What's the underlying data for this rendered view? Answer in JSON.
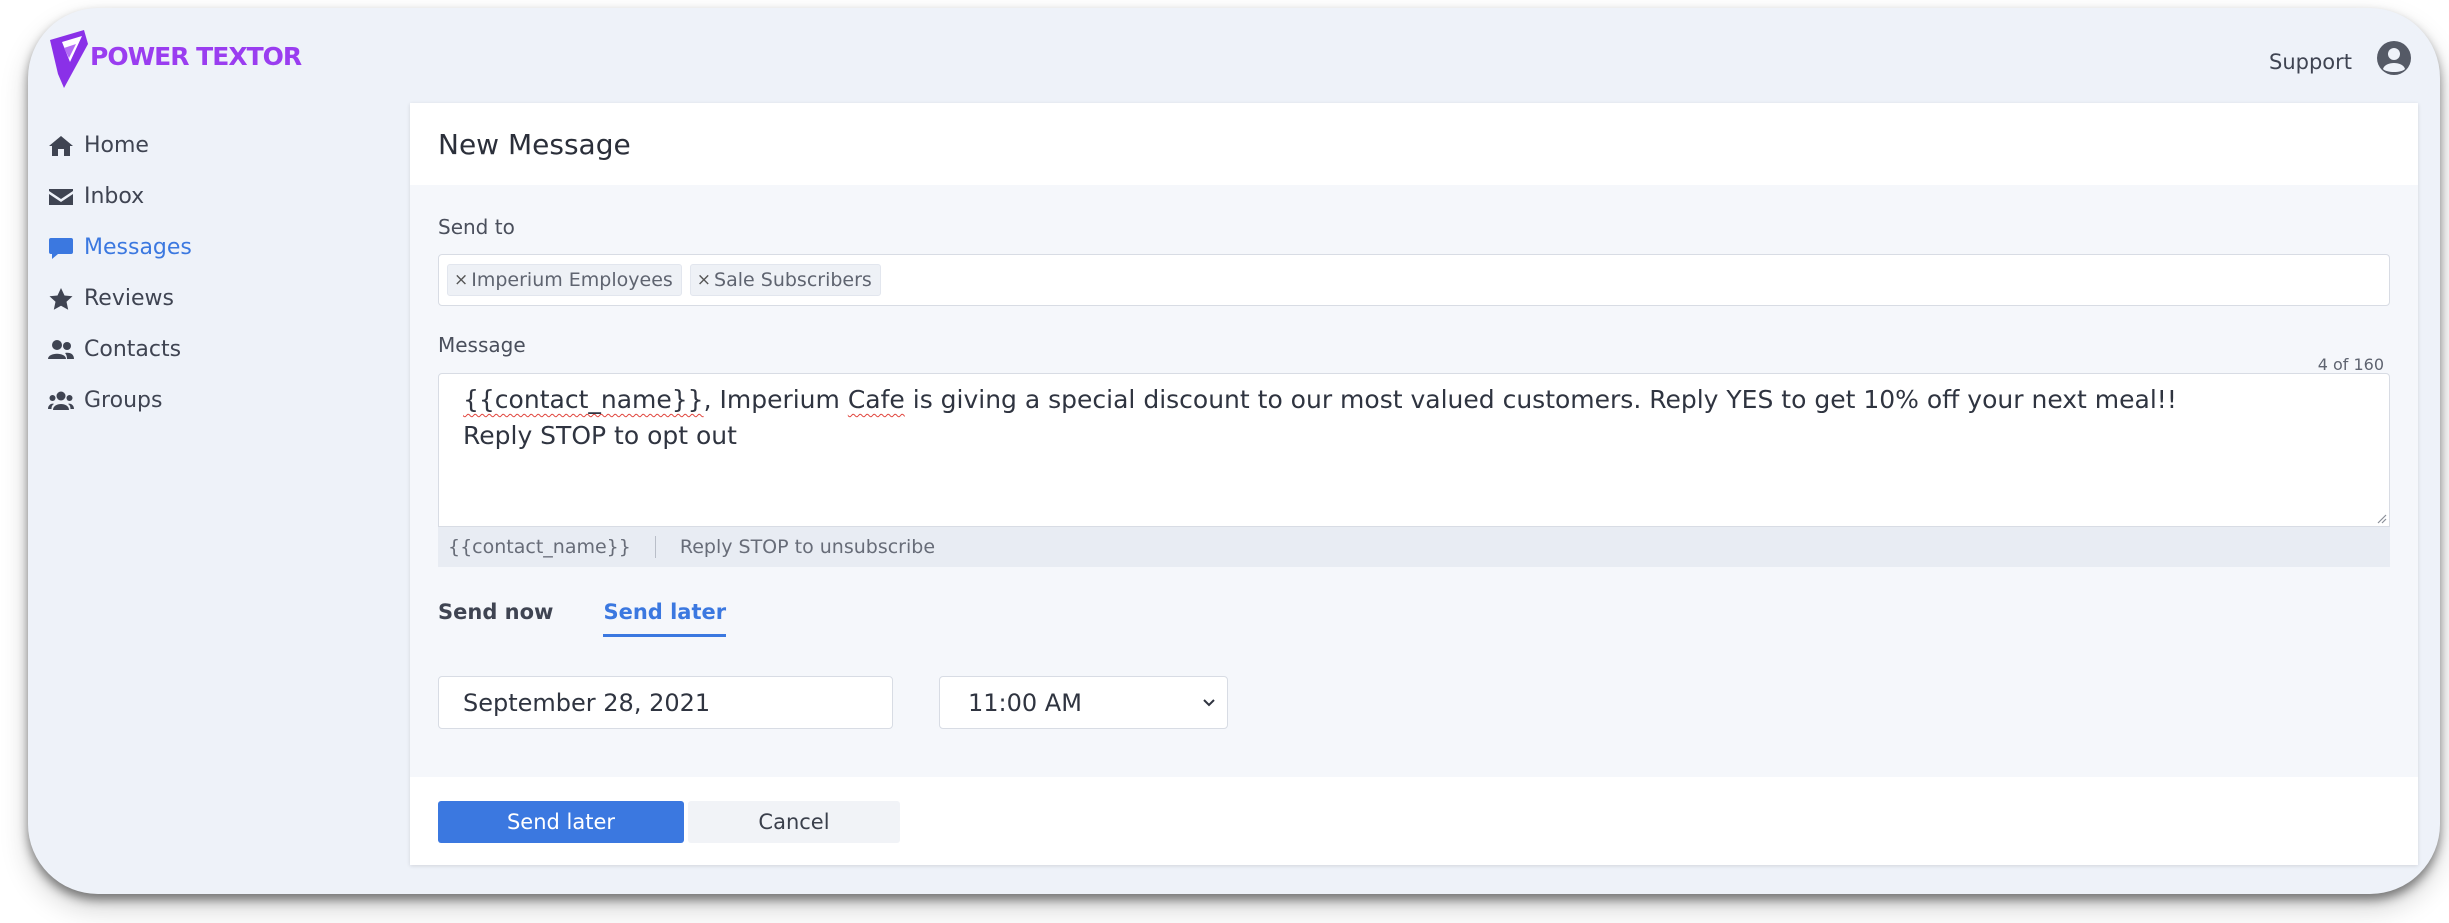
{
  "app": {
    "brand": "POWER TEXTOR",
    "brand_color": "#9a3df0",
    "accent_color": "#3b78e0",
    "support_label": "Support"
  },
  "sidebar": {
    "items": [
      {
        "label": "Home",
        "icon": "home-icon",
        "active": false
      },
      {
        "label": "Inbox",
        "icon": "envelope-icon",
        "active": false
      },
      {
        "label": "Messages",
        "icon": "chat-icon",
        "active": true
      },
      {
        "label": "Reviews",
        "icon": "star-icon",
        "active": false
      },
      {
        "label": "Contacts",
        "icon": "users-icon",
        "active": false
      },
      {
        "label": "Groups",
        "icon": "group-icon",
        "active": false
      }
    ]
  },
  "form": {
    "title": "New Message",
    "send_to_label": "Send to",
    "recipients": [
      "Imperium Employees",
      "Sale Subscribers"
    ],
    "message_label": "Message",
    "char_counter": "4 of 160",
    "message_parts": {
      "token": "{{contact_name}}",
      "after_token": ", Imperium ",
      "misspelled": "Cafe",
      "rest_line1": " is giving a special discount to our most valued customers. Reply YES to get 10% off your next meal!!",
      "line2": "Reply STOP to opt out"
    },
    "snippets": [
      "{{contact_name}}",
      "Reply STOP to unsubscribe"
    ],
    "tabs": [
      {
        "label": "Send now",
        "active": false
      },
      {
        "label": "Send later",
        "active": true
      }
    ],
    "date_value": "September 28, 2021",
    "time_value": "11:00 AM",
    "submit_label": "Send later",
    "cancel_label": "Cancel"
  }
}
